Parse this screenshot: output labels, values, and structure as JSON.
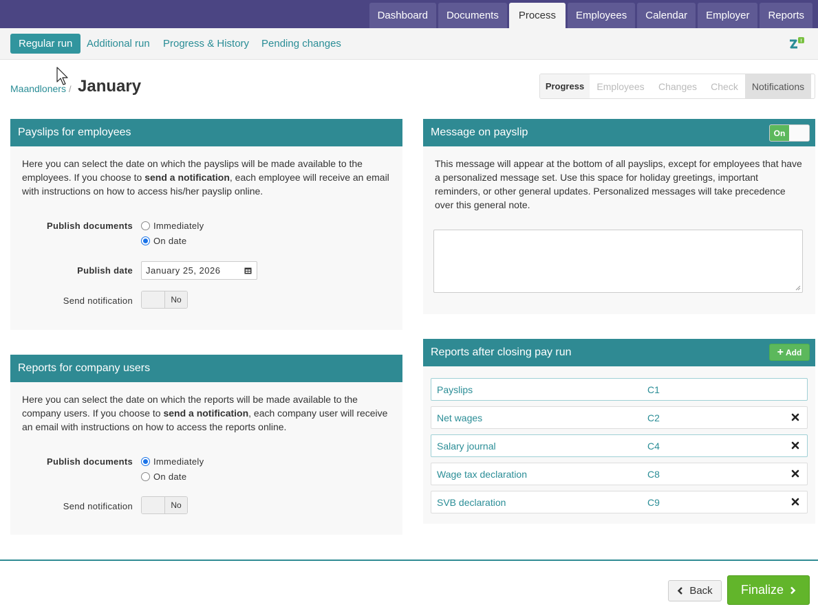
{
  "colors": {
    "topbar": "#4b4583",
    "teal": "#2f8a93",
    "link": "#2a8d96",
    "green": "#5cb85c",
    "finalize": "#62b52b"
  },
  "main_nav": {
    "tabs": [
      {
        "label": "Dashboard"
      },
      {
        "label": "Documents"
      },
      {
        "label": "Process"
      },
      {
        "label": "Employees"
      },
      {
        "label": "Calendar"
      },
      {
        "label": "Employer"
      },
      {
        "label": "Reports"
      }
    ],
    "active": "Process"
  },
  "sub_nav": {
    "tabs": [
      {
        "label": "Regular run"
      },
      {
        "label": "Additional run"
      },
      {
        "label": "Progress & History"
      },
      {
        "label": "Pending changes"
      }
    ],
    "active": "Regular run",
    "icon": "notifications-icon"
  },
  "breadcrumb": {
    "parent": "Maandloners",
    "separator": "/",
    "current": "January"
  },
  "steps": {
    "items": [
      {
        "label": "Progress"
      },
      {
        "label": "Employees"
      },
      {
        "label": "Changes"
      },
      {
        "label": "Check"
      },
      {
        "label": "Notifications"
      }
    ]
  },
  "payslips_panel": {
    "title": "Payslips for employees",
    "text_before": "Here you can select the date on which the payslips will be made available to the employees. If you choose to ",
    "text_bold": "send a notification",
    "text_after": ", each employee will receive an email with instructions on how to access his/her payslip online.",
    "publish_label": "Publish documents",
    "option_immediately": "Immediately",
    "option_on_date": "On date",
    "selected_option": "On date",
    "date_label": "Publish date",
    "date_value": "January 25, 2026",
    "notify_label": "Send notification",
    "notify_value": "No"
  },
  "company_panel": {
    "title": "Reports for company users",
    "text_before": "Here you can select the date on which the reports will be made available to the company users. If you choose to ",
    "text_bold": "send a notification",
    "text_after": ", each company user will receive an email with instructions on how to access the reports online.",
    "publish_label": "Publish documents",
    "option_immediately": "Immediately",
    "option_on_date": "On date",
    "selected_option": "Immediately",
    "notify_label": "Send notification",
    "notify_value": "No"
  },
  "message_panel": {
    "title": "Message on payslip",
    "toggle_label": "On",
    "text": "This message will appear at the bottom of all payslips, except for employees that have a personalized message set. Use this space for holiday greetings, important reminders, or other general updates. Personalized messages will take precedence over this general note.",
    "textarea_value": ""
  },
  "reports_panel": {
    "title": "Reports after closing pay run",
    "add_label": "Add",
    "rows": [
      {
        "name": "Payslips",
        "code": "C1",
        "removable": false
      },
      {
        "name": "Net wages",
        "code": "C2",
        "removable": true
      },
      {
        "name": "Salary journal",
        "code": "C4",
        "removable": true
      },
      {
        "name": "Wage tax declaration",
        "code": "C8",
        "removable": true
      },
      {
        "name": "SVB declaration",
        "code": "C9",
        "removable": true
      }
    ]
  },
  "footer": {
    "back_label": "Back",
    "finalize_label": "Finalize"
  }
}
